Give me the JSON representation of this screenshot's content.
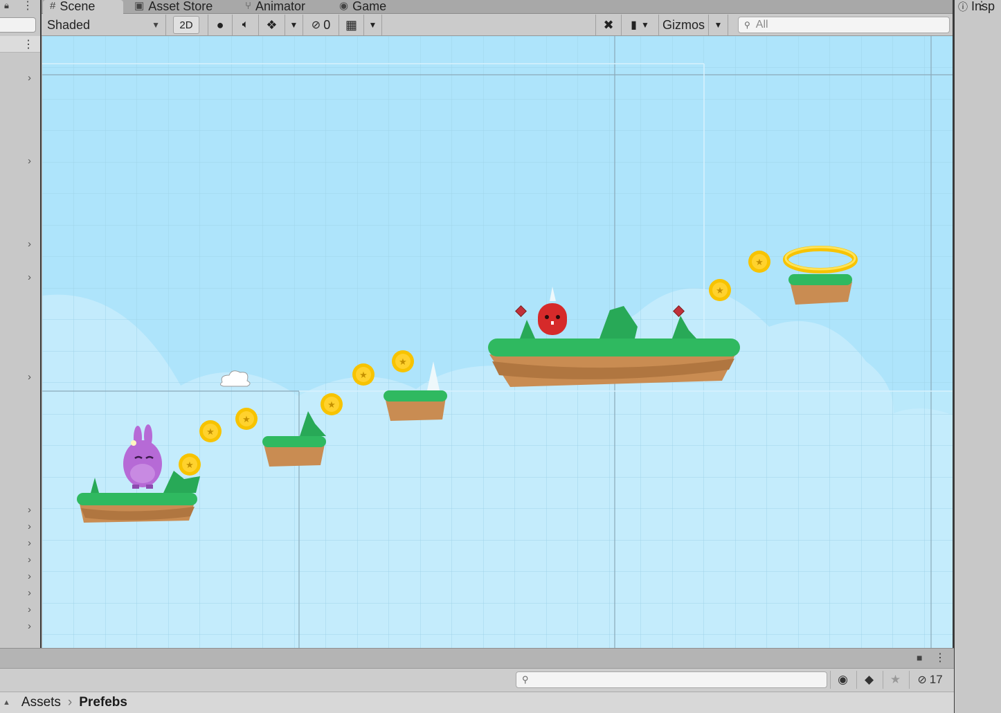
{
  "tabs": [
    {
      "label": "Scene",
      "icon": "grid-icon",
      "glyph": "#",
      "active": true
    },
    {
      "label": "Asset Store",
      "icon": "store-icon",
      "glyph": "▣",
      "active": false
    },
    {
      "label": "Animator",
      "icon": "animator-icon",
      "glyph": "⑂",
      "active": false
    },
    {
      "label": "Game",
      "icon": "gamepad-icon",
      "glyph": "◉",
      "active": false
    }
  ],
  "inspector_tab": {
    "label": "Insp"
  },
  "toolbar": {
    "shading_mode": "Shaded",
    "mode_2d": "2D",
    "hidden_count": "0",
    "gizmos_label": "Gizmos",
    "search_placeholder": "All"
  },
  "bottom": {
    "hidden_assets_count": "17"
  },
  "breadcrumb": {
    "root": "Assets",
    "current": "Prefebs"
  },
  "colors": {
    "sky": "#aee4fb",
    "grass": "#2fb960",
    "dirt": "#c98c52",
    "coin": "#f7c300",
    "bunny": "#b66ad6",
    "enemy": "#d62a2a"
  }
}
